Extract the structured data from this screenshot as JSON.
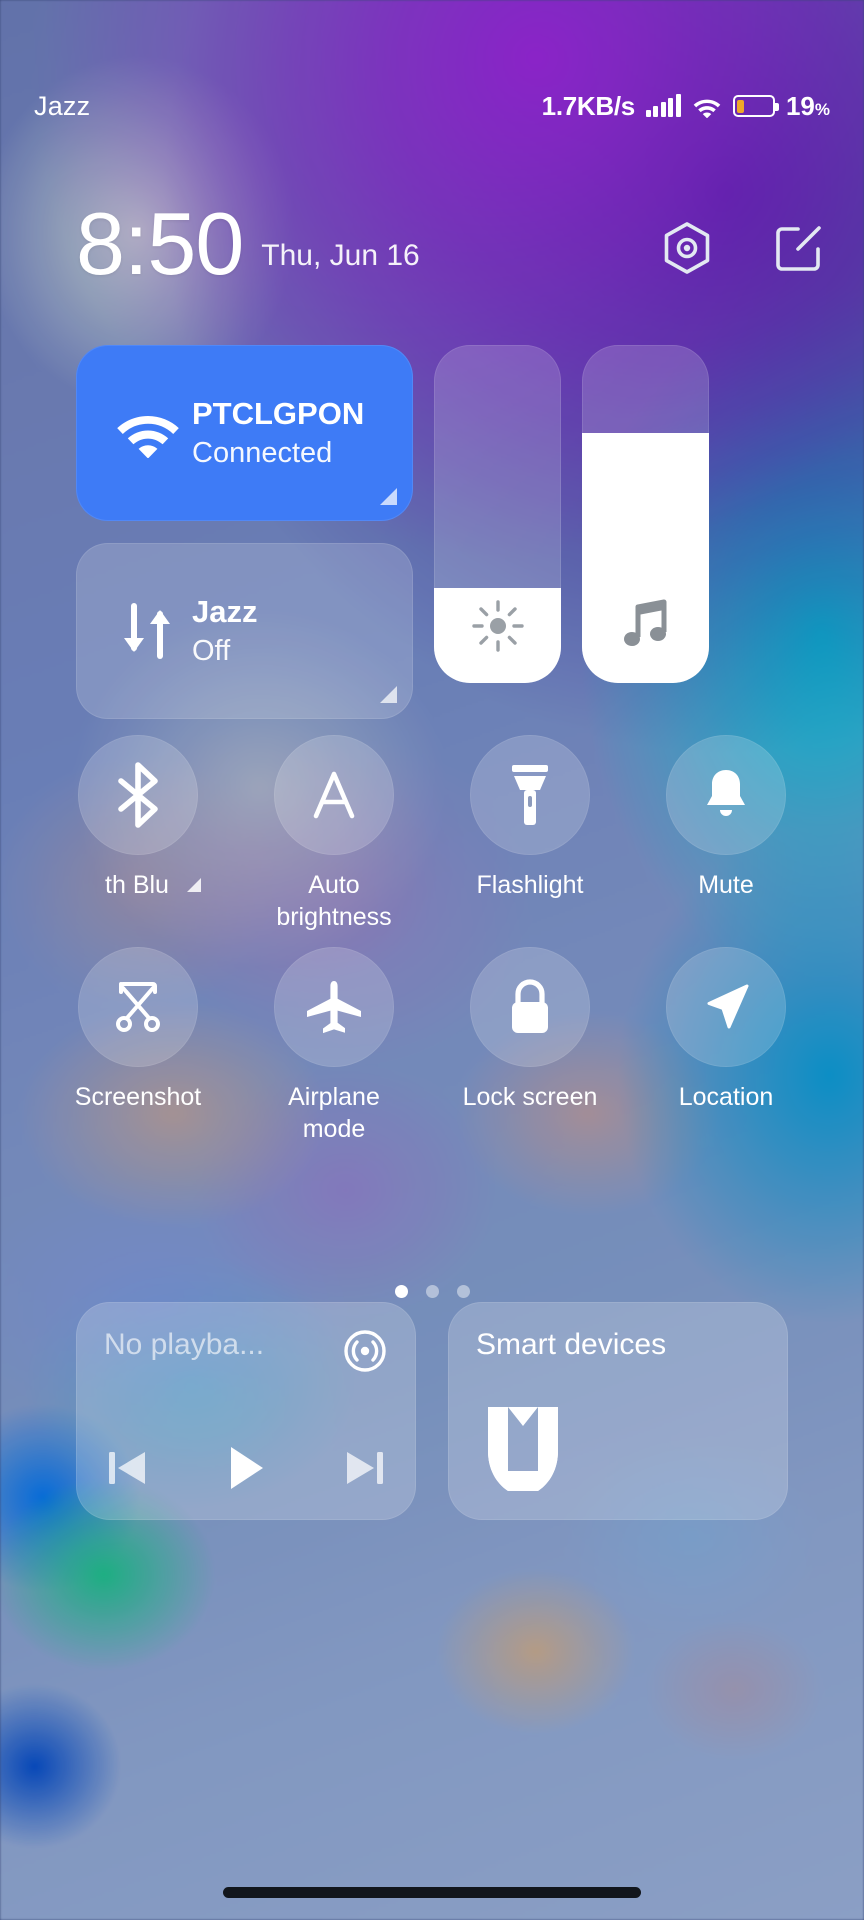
{
  "status_bar": {
    "carrier": "Jazz",
    "network_speed": "1.7KB/s",
    "battery_percent": "19",
    "battery_percent_symbol": "%",
    "battery_level": 19,
    "signal_bars": 5,
    "wifi_icon": "wifi-icon"
  },
  "header": {
    "time": "8:50",
    "date": "Thu, Jun 16",
    "settings_icon": "settings-gear-icon",
    "edit_icon": "edit-pencil-icon"
  },
  "tiles": {
    "wifi": {
      "title": "PTCLGPON",
      "subtitle": "Connected",
      "active": true,
      "accent": "#3e7bf6",
      "icon": "wifi-icon"
    },
    "mobile_data": {
      "title": "Jazz",
      "subtitle": "Off",
      "active": false,
      "icon": "data-transfer-icon"
    },
    "brightness_slider": {
      "label": "Brightness",
      "value_percent": 28,
      "icon": "sun-icon"
    },
    "volume_slider": {
      "label": "Media volume",
      "value_percent": 74,
      "icon": "music-note-icon"
    }
  },
  "toggles": [
    {
      "label": "th   Blu",
      "icon": "bluetooth-icon",
      "name": "bluetooth",
      "marquee": true
    },
    {
      "label": "Auto brightness",
      "icon": "auto-brightness-a-icon",
      "name": "auto-brightness"
    },
    {
      "label": "Flashlight",
      "icon": "flashlight-icon",
      "name": "flashlight"
    },
    {
      "label": "Mute",
      "icon": "bell-icon",
      "name": "mute"
    },
    {
      "label": "Screenshot",
      "icon": "scissors-icon",
      "name": "screenshot"
    },
    {
      "label": "Airplane mode",
      "icon": "airplane-icon",
      "name": "airplane-mode"
    },
    {
      "label": "Lock screen",
      "icon": "padlock-icon",
      "name": "lock-screen"
    },
    {
      "label": "Location",
      "icon": "location-arrow-icon",
      "name": "location"
    }
  ],
  "pagination": {
    "total": 3,
    "active_index": 0
  },
  "cards": {
    "media": {
      "title": "No playba...",
      "cast_icon": "cast-icon",
      "prev_label": "previous-track",
      "play_label": "play",
      "next_label": "next-track"
    },
    "smart_devices": {
      "title": "Smart devices",
      "logo": "mi-home-logo"
    }
  }
}
